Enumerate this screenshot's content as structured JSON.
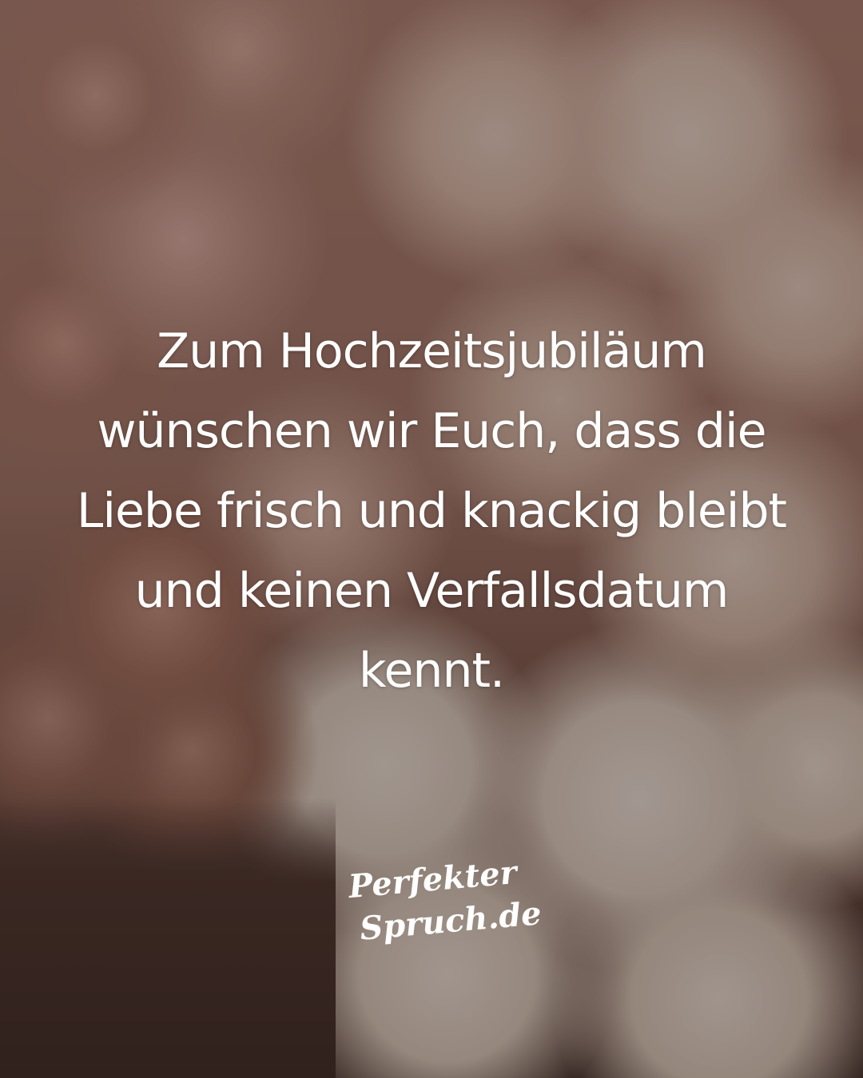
{
  "quote": {
    "lines": [
      "Zum Hochzeitsjubiläum",
      "wünschen wir Euch, dass die",
      "Liebe frisch und knackig bleibt",
      "und keinen Verfallsdatum",
      "kennt."
    ]
  },
  "logo": {
    "line1": "Perfekter",
    "line2": "Spruch.de"
  },
  "colors": {
    "text": "#ffffff",
    "overlay": "#231916"
  }
}
